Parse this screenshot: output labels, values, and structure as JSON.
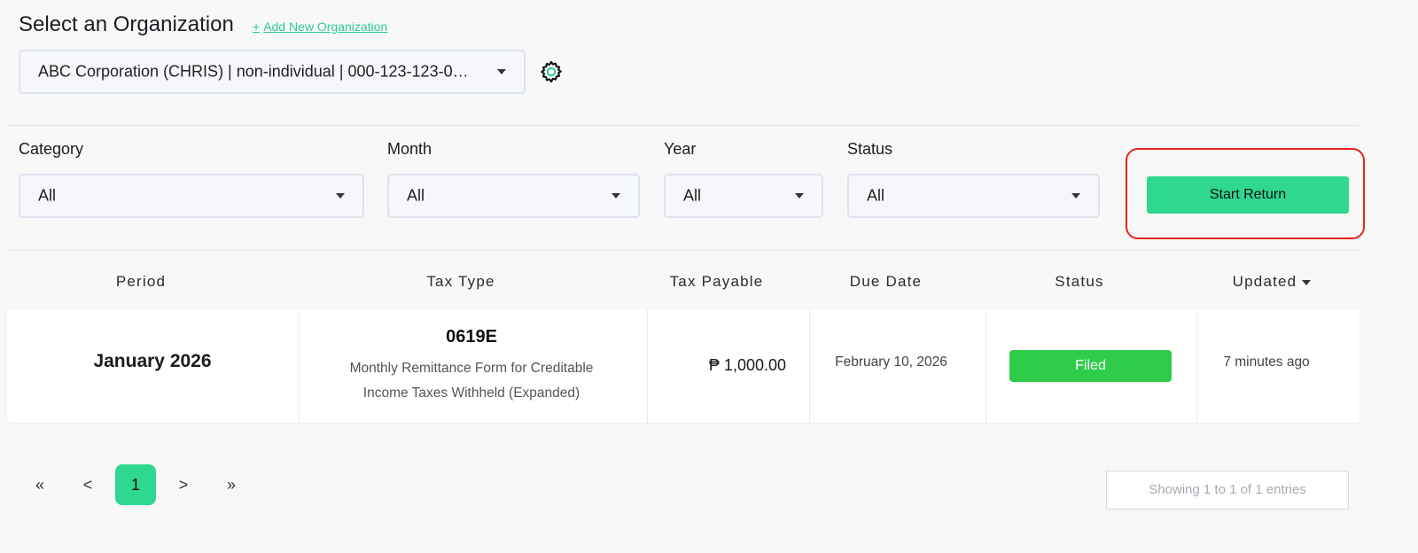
{
  "header": {
    "title": "Select an Organization",
    "add_org_plus": "+",
    "add_org_label": "Add New Organization",
    "org_selected": "ABC Corporation (CHRIS) | non-individual | 000-123-123-0…"
  },
  "filters": {
    "category": {
      "label": "Category",
      "value": "All"
    },
    "month": {
      "label": "Month",
      "value": "All"
    },
    "year": {
      "label": "Year",
      "value": "All"
    },
    "status": {
      "label": "Status",
      "value": "All"
    }
  },
  "actions": {
    "start_return": "Start Return"
  },
  "table": {
    "headers": {
      "period": "Period",
      "tax_type": "Tax Type",
      "tax_payable": "Tax Payable",
      "due_date": "Due Date",
      "status": "Status",
      "updated": "Updated"
    },
    "rows": [
      {
        "period": "January 2026",
        "tax_code": "0619E",
        "tax_desc_1": "Monthly Remittance Form for Creditable",
        "tax_desc_2": "Income Taxes Withheld (Expanded)",
        "tax_payable": "₱ 1,000.00",
        "due_date": "February 10, 2026",
        "status": "Filed",
        "updated": "7 minutes ago"
      }
    ]
  },
  "pagination": {
    "first": "«",
    "prev": "<",
    "current": "1",
    "next": ">",
    "last": "»",
    "summary": "Showing 1 to 1 of 1 entries"
  },
  "colors": {
    "accent": "#2ed88f",
    "filed": "#2fcc4a",
    "highlight": "#e8241c"
  }
}
